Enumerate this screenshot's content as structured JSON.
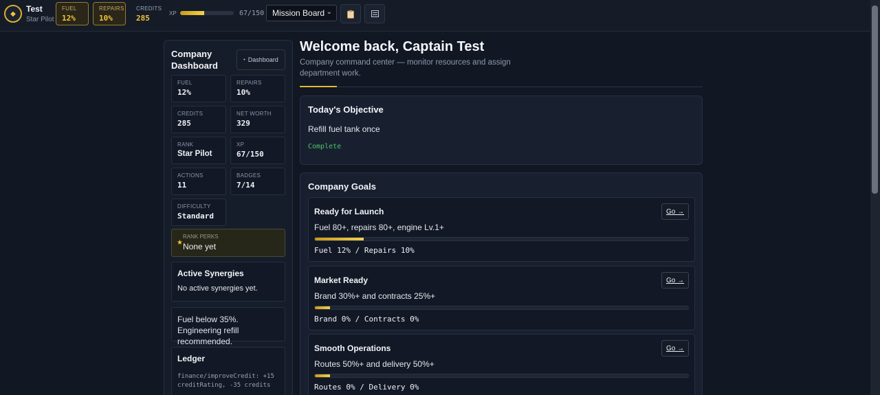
{
  "topbar": {
    "logo_icon": "diamond-icon",
    "player_name": "Test",
    "player_rank": "Star Pilot",
    "stats": [
      {
        "label": "FUEL",
        "value": "12%"
      },
      {
        "label": "REPAIRS",
        "value": "10%"
      },
      {
        "label": "CREDITS",
        "value": "285"
      }
    ],
    "xp_label": "XP",
    "xp_progress": 0.447,
    "xp_text": "67/150",
    "view_select": "Mission Board",
    "icon_buttons": [
      "clipboard-icon",
      "list-icon"
    ]
  },
  "sidebar": {
    "title": "Company Dashboard",
    "dashboard_button": "Dashboard",
    "tiles": [
      {
        "label": "FUEL",
        "value": "12%"
      },
      {
        "label": "REPAIRS",
        "value": "10%"
      },
      {
        "label": "CREDITS",
        "value": "285"
      },
      {
        "label": "NET WORTH",
        "value": "329"
      },
      {
        "label": "RANK",
        "value": "Star Pilot"
      },
      {
        "label": "XP",
        "value": "67/150"
      },
      {
        "label": "ACTIONS",
        "value": "11"
      },
      {
        "label": "BADGES",
        "value": "7/14"
      },
      {
        "label": "DIFFICULTY",
        "value": "Standard"
      }
    ],
    "rank_perks": {
      "label": "RANK PERKS",
      "value": "None yet"
    },
    "synergies": {
      "title": "Active Synergies",
      "text": "No active synergies yet."
    },
    "warning": "Fuel below 35%. Engineering refill recommended.",
    "ledger": {
      "title": "Ledger",
      "text": "finance/improveCredit: +15 creditRating, -35 credits"
    }
  },
  "main": {
    "welcome": "Welcome back, Captain Test",
    "subtitle": "Company command center — monitor resources and assign department work.",
    "objective": {
      "title": "Today's Objective",
      "text": "Refill fuel tank once",
      "status": "Complete"
    },
    "goals_title": "Company Goals",
    "goals": [
      {
        "title": "Ready for Launch",
        "description": "Fuel 80+, repairs 80+, engine Lv.1+",
        "progress": 0.13,
        "status": "Fuel 12% / Repairs 10%",
        "button": "Go →"
      },
      {
        "title": "Market Ready",
        "description": "Brand 30%+ and contracts 25%+",
        "progress": 0.04,
        "status": "Brand 0% / Contracts 0%",
        "button": "Go →"
      },
      {
        "title": "Smooth Operations",
        "description": "Routes 50%+ and delivery 50%+",
        "progress": 0.04,
        "status": "Routes 0% / Delivery 0%",
        "button": "Go →"
      }
    ]
  },
  "colors": {
    "accent": "#f0c43a",
    "success": "#4fc36a",
    "background": "#111723"
  }
}
